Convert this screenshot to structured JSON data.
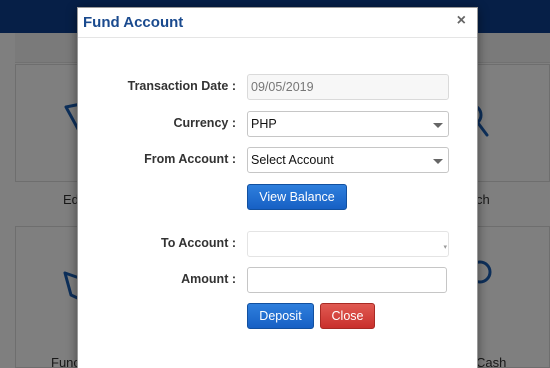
{
  "background": {
    "tiles": [
      {
        "label": "Ed",
        "icon": "send-icon"
      },
      {
        "label": "ch",
        "icon": "magnifier-icon"
      },
      {
        "label": "Func",
        "icon": "wallet-icon"
      },
      {
        "label": "Cash",
        "icon": "coin-icon"
      }
    ]
  },
  "modal": {
    "title": "Fund Account",
    "close_glyph": "×",
    "transaction_date": {
      "label": "Transaction Date :",
      "value": "09/05/2019"
    },
    "currency": {
      "label": "Currency :",
      "selected": "PHP"
    },
    "from_account": {
      "label": "From Account :",
      "selected": "Select Account"
    },
    "view_balance_label": "View Balance",
    "to_account": {
      "label": "To Account :",
      "value": ""
    },
    "amount": {
      "label": "Amount :",
      "value": ""
    },
    "deposit_label": "Deposit",
    "close_label": "Close"
  },
  "colors": {
    "topbar": "#0d3f8f",
    "title": "#1a4a8e",
    "primary_button": "#1760c4",
    "danger_button": "#c9302c"
  }
}
